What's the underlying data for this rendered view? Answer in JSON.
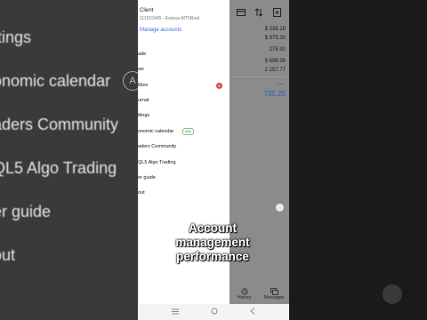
{
  "background": {
    "items": [
      "ttings",
      "onomic calendar",
      "aders Community",
      "QL5 Algo Trading",
      "er guide",
      "out"
    ],
    "badge": "A"
  },
  "drawer": {
    "account_name": "Client",
    "account_sub": "111515945 - Exness-MT5Real",
    "manage_accounts": "Manage accounts",
    "items": [
      "ade",
      "ws",
      "ilbox",
      "urnal",
      "ttings",
      "onomic calendar",
      "aders Community",
      "QL5 Algo Trading",
      "er guide",
      "out"
    ],
    "mailbox_count": "5",
    "ads_tag": "Ads"
  },
  "panel": {
    "values": [
      "$ 236.18",
      "$ 975.30",
      "276.92",
      "$ 698.38",
      "2 157.77"
    ],
    "menu": "...",
    "highlight": "735.20",
    "tabs": {
      "history": "History",
      "messages": "Messages"
    }
  },
  "caption": "Account management performance",
  "icons": {
    "card": "credit-card-icon",
    "sort": "sort-arrows-icon",
    "add": "add-document-icon",
    "history": "history-icon",
    "messages": "messages-icon"
  }
}
